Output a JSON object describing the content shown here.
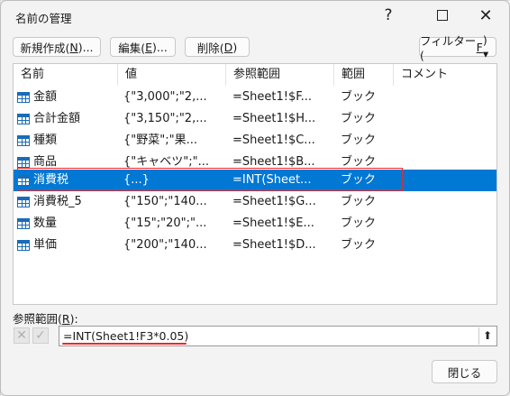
{
  "window": {
    "title": "名前の管理",
    "help_glyph": "?",
    "close_glyph": "✕"
  },
  "toolbar": {
    "new_label": "新規作成(",
    "new_key": "N",
    "new_suffix": ")...",
    "edit_label": "編集(",
    "edit_key": "E",
    "edit_suffix": ")...",
    "delete_label": "削除(",
    "delete_key": "D",
    "delete_suffix": ")",
    "filter_label": "フィルター(",
    "filter_key": "F",
    "filter_suffix": ") ▾"
  },
  "table": {
    "headers": [
      "名前",
      "値",
      "参照範囲",
      "範囲",
      "コメント"
    ],
    "rows": [
      {
        "name": "金額",
        "value": "{\"3,000\";\"2,...",
        "ref": "=Sheet1!$F...",
        "scope": "ブック",
        "comment": ""
      },
      {
        "name": "合計金額",
        "value": "{\"3,150\";\"2,...",
        "ref": "=Sheet1!$H...",
        "scope": "ブック",
        "comment": ""
      },
      {
        "name": "種類",
        "value": "{\"野菜\";\"果...",
        "ref": "=Sheet1!$C...",
        "scope": "ブック",
        "comment": ""
      },
      {
        "name": "商品",
        "value": "{\"キャベツ\";\"...",
        "ref": "=Sheet1!$B...",
        "scope": "ブック",
        "comment": ""
      },
      {
        "name": "消費税",
        "value": "{...}",
        "ref": "=INT(Sheet...",
        "scope": "ブック",
        "comment": "",
        "selected": true
      },
      {
        "name": "消費税_5",
        "value": "{\"150\";\"140...",
        "ref": "=Sheet1!$G...",
        "scope": "ブック",
        "comment": ""
      },
      {
        "name": "数量",
        "value": "{\"15\";\"20\";\"...",
        "ref": "=Sheet1!$E...",
        "scope": "ブック",
        "comment": ""
      },
      {
        "name": "単価",
        "value": "{\"200\";\"140...",
        "ref": "=Sheet1!$D...",
        "scope": "ブック",
        "comment": ""
      }
    ]
  },
  "reference": {
    "label": "参照範囲(",
    "label_key": "R",
    "label_suffix": "):",
    "value": "=INT(Sheet1!F3*0.05)",
    "cancel_glyph": "✕",
    "ok_glyph": "✓",
    "collapse_glyph": "⬆"
  },
  "footer": {
    "close_label": "閉じる"
  },
  "colors": {
    "selection": "#0078d4",
    "highlight_outline": "#e02b2b"
  }
}
